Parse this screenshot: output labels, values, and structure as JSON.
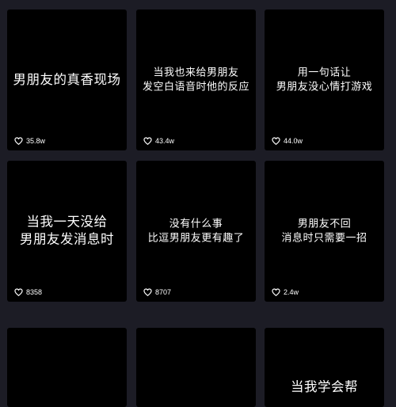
{
  "cards": [
    {
      "caption": "男朋友的真香现场",
      "likes": "35.8w",
      "heart_icon": "heart-outline-icon"
    },
    {
      "caption": "当我也来给男朋友\n发空白语音时他的反应",
      "likes": "43.4w",
      "heart_icon": "heart-outline-icon"
    },
    {
      "caption": "用一句话让\n男朋友没心情打游戏",
      "likes": "44.0w",
      "heart_icon": "heart-outline-icon"
    },
    {
      "caption": "当我一天没给\n男朋友发消息时",
      "likes": "8358",
      "heart_icon": "heart-outline-icon"
    },
    {
      "caption": "没有什么事\n比逗男朋友更有趣了",
      "likes": "8707",
      "heart_icon": "heart-outline-icon"
    },
    {
      "caption": "男朋友不回\n消息时只需要一招",
      "likes": "2.4w",
      "heart_icon": "heart-outline-icon"
    },
    {
      "caption": ""
    },
    {
      "caption": ""
    },
    {
      "caption": "当我学会帮"
    }
  ],
  "colors": {
    "background": "#1c1c25",
    "card": "#000000",
    "text": "#ffffff"
  }
}
